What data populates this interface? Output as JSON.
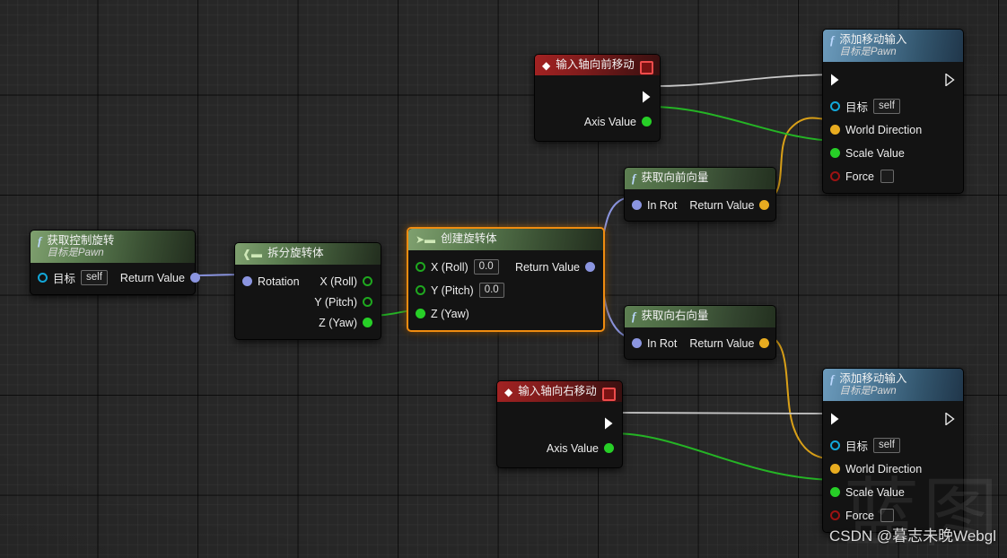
{
  "app": {
    "kind": "unreal-blueprint-graph",
    "watermark_text": "CSDN @暮志未晚Webgl",
    "watermark_big": "蓝图"
  },
  "colors": {
    "exec_wire": "#c9c9c9",
    "float_wire": "#25b425",
    "vector_wire": "#d9a018",
    "struct_wire": "#8b95e0",
    "selection": "#f08c10",
    "pin_exec": "#ffffff",
    "pin_float": "#27cf27",
    "pin_vector": "#e8ac20",
    "pin_struct": "#8b95e0",
    "pin_object": "#12a7d8",
    "pin_bool": "#9c1212"
  },
  "nodes": {
    "get_control_rotation": {
      "title": "获取控制旋转",
      "subtitle": "目标是Pawn",
      "icon": "function-f-icon",
      "inputs": [
        {
          "label": "目标",
          "value": "self",
          "pin": "object"
        }
      ],
      "outputs": [
        {
          "label": "Return Value",
          "pin": "struct"
        }
      ]
    },
    "break_rotator": {
      "title": "拆分旋转体",
      "icon": "break-struct-icon",
      "inputs": [
        {
          "label": "Rotation",
          "pin": "struct"
        }
      ],
      "outputs": [
        {
          "label": "X (Roll)",
          "pin": "float-ring"
        },
        {
          "label": "Y (Pitch)",
          "pin": "float-ring"
        },
        {
          "label": "Z (Yaw)",
          "pin": "float"
        }
      ]
    },
    "make_rotator": {
      "title": "创建旋转体",
      "icon": "make-struct-icon",
      "selected": true,
      "inputs": [
        {
          "label": "X (Roll)",
          "value": "0.0",
          "pin": "float-ring"
        },
        {
          "label": "Y (Pitch)",
          "value": "0.0",
          "pin": "float-ring"
        },
        {
          "label": "Z (Yaw)",
          "pin": "float"
        }
      ],
      "outputs": [
        {
          "label": "Return Value",
          "pin": "struct"
        }
      ]
    },
    "input_axis_move_forward": {
      "title": "输入轴向前移动",
      "icon": "event-diamond-icon",
      "outputs": [
        {
          "label": "",
          "pin": "exec"
        },
        {
          "label": "Axis Value",
          "pin": "float"
        }
      ]
    },
    "input_axis_move_right": {
      "title": "输入轴向右移动",
      "icon": "event-diamond-icon",
      "outputs": [
        {
          "label": "",
          "pin": "exec"
        },
        {
          "label": "Axis Value",
          "pin": "float"
        }
      ]
    },
    "get_forward_vector": {
      "title": "获取向前向量",
      "icon": "function-f-icon",
      "inputs": [
        {
          "label": "In Rot",
          "pin": "struct"
        }
      ],
      "outputs": [
        {
          "label": "Return Value",
          "pin": "vector"
        }
      ]
    },
    "get_right_vector": {
      "title": "获取向右向量",
      "icon": "function-f-icon",
      "inputs": [
        {
          "label": "In Rot",
          "pin": "struct"
        }
      ],
      "outputs": [
        {
          "label": "Return Value",
          "pin": "vector"
        }
      ]
    },
    "add_movement_input_forward": {
      "title": "添加移动输入",
      "subtitle": "目标是Pawn",
      "icon": "function-f-icon",
      "inputs": [
        {
          "label": "",
          "pin": "exec"
        },
        {
          "label": "目标",
          "value": "self",
          "pin": "object"
        },
        {
          "label": "World Direction",
          "pin": "vector"
        },
        {
          "label": "Scale Value",
          "pin": "float"
        },
        {
          "label": "Force",
          "value": "",
          "pin": "bool"
        }
      ],
      "outputs": [
        {
          "label": "",
          "pin": "exec-out"
        }
      ]
    },
    "add_movement_input_right": {
      "title": "添加移动输入",
      "subtitle": "目标是Pawn",
      "icon": "function-f-icon",
      "inputs": [
        {
          "label": "",
          "pin": "exec"
        },
        {
          "label": "目标",
          "value": "self",
          "pin": "object"
        },
        {
          "label": "World Direction",
          "pin": "vector"
        },
        {
          "label": "Scale Value",
          "pin": "float"
        },
        {
          "label": "Force",
          "value": "",
          "pin": "bool"
        }
      ],
      "outputs": [
        {
          "label": "",
          "pin": "exec-out"
        }
      ]
    }
  }
}
